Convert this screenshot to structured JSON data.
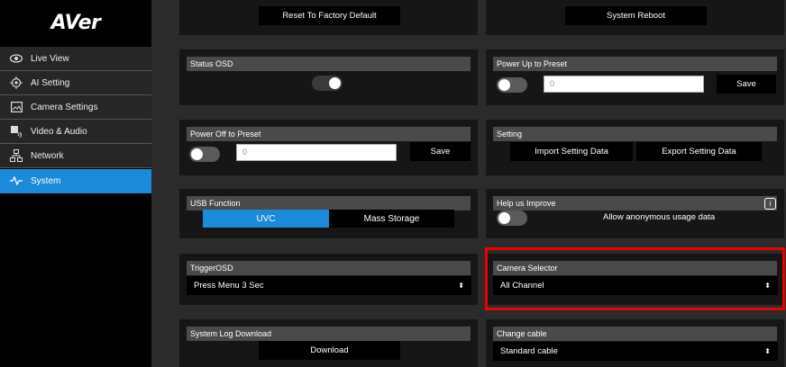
{
  "app": {
    "logo": "AVer"
  },
  "sidebar": {
    "items": [
      {
        "label": "Live View",
        "icon": "eye-icon"
      },
      {
        "label": "AI Setting",
        "icon": "ai-target-icon"
      },
      {
        "label": "Camera Settings",
        "icon": "image-icon"
      },
      {
        "label": "Video & Audio",
        "icon": "video-audio-icon"
      },
      {
        "label": "Network",
        "icon": "network-icon"
      },
      {
        "label": "System",
        "icon": "pulse-icon",
        "active": true
      }
    ]
  },
  "panels": {
    "reset": {
      "button": "Reset To Factory Default"
    },
    "reboot": {
      "button": "System Reboot"
    },
    "status_osd": {
      "title": "Status OSD"
    },
    "power_up": {
      "title": "Power Up to Preset",
      "value": "0",
      "save": "Save"
    },
    "power_off": {
      "title": "Power Off to Preset",
      "value": "0",
      "save": "Save"
    },
    "setting": {
      "title": "Setting",
      "import": "Import Setting Data",
      "export": "Export Setting Data"
    },
    "usb": {
      "title": "USB Function",
      "options": [
        "UVC",
        "Mass Storage"
      ],
      "selected": "UVC"
    },
    "improve": {
      "title": "Help us Improve",
      "text": "Allow anonymous usage data"
    },
    "trigger_osd": {
      "title": "TriggerOSD",
      "selected": "Press Menu 3 Sec"
    },
    "camera_selector": {
      "title": "Camera Selector",
      "selected": "All Channel"
    },
    "system_log": {
      "title": "System Log Download",
      "button": "Download"
    },
    "change_cable": {
      "title": "Change cable",
      "selected": "Standard cable"
    }
  },
  "colors": {
    "accent": "#1b8ad8",
    "highlight": "#e00000"
  }
}
